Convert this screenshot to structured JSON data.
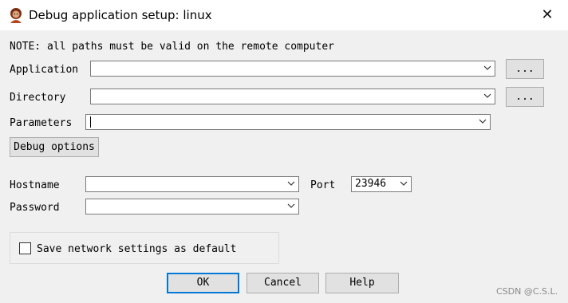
{
  "window": {
    "title": "Debug application setup: linux",
    "close_glyph": "✕"
  },
  "note": "NOTE: all paths must be valid on the remote computer",
  "fields": {
    "application": {
      "label": "Application",
      "value": "",
      "browse": "..."
    },
    "directory": {
      "label": "Directory",
      "value": "",
      "browse": "..."
    },
    "parameters": {
      "label": "Parameters",
      "value": ""
    }
  },
  "debug_options_label": "Debug options",
  "network": {
    "hostname": {
      "label": "Hostname",
      "value": ""
    },
    "port": {
      "label": "Port",
      "value": "23946"
    },
    "password": {
      "label": "Password",
      "value": ""
    },
    "save_default": {
      "label": "Save network settings as default",
      "checked": false
    }
  },
  "buttons": {
    "ok": "OK",
    "cancel": "Cancel",
    "help": "Help"
  },
  "watermark": "CSDN @C.S.L.",
  "colors": {
    "titlebar": "#ffffff",
    "dialog": "#f0f0f0",
    "focus": "#0078d7",
    "button": "#e1e1e1"
  },
  "icons": {
    "app": "ida-lady-icon",
    "close": "close-icon",
    "dropdown": "chevron-down-icon"
  }
}
